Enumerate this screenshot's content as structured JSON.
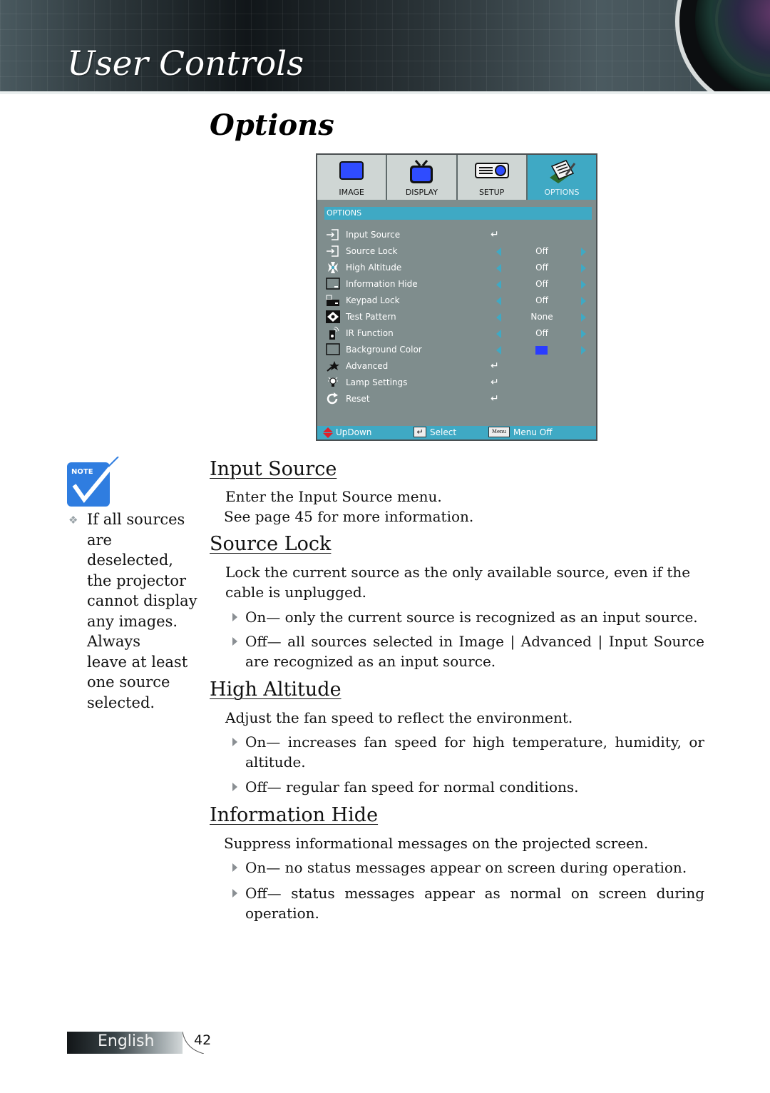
{
  "header": {
    "title": "User Controls",
    "section_title": "Options"
  },
  "osd_menu": {
    "tabs": [
      {
        "label": "IMAGE",
        "icon": "image-monitor-icon",
        "active": false
      },
      {
        "label": "DISPLAY",
        "icon": "display-tv-icon",
        "active": false
      },
      {
        "label": "SETUP",
        "icon": "setup-projector-icon",
        "active": false
      },
      {
        "label": "OPTIONS",
        "icon": "options-notepad-icon",
        "active": true
      }
    ],
    "subheader": "OPTIONS",
    "items": [
      {
        "label": "Input Source",
        "icon": "input-source-icon",
        "type": "enter",
        "value": ""
      },
      {
        "label": "Source Lock",
        "icon": "source-lock-icon",
        "type": "select",
        "value": "Off"
      },
      {
        "label": "High Altitude",
        "icon": "fan-icon",
        "type": "select",
        "value": "Off"
      },
      {
        "label": "Information Hide",
        "icon": "info-hide-icon",
        "type": "select",
        "value": "Off"
      },
      {
        "label": "Keypad Lock",
        "icon": "keypad-lock-icon",
        "type": "select",
        "value": "Off"
      },
      {
        "label": "Test Pattern",
        "icon": "test-pattern-icon",
        "type": "select",
        "value": "None"
      },
      {
        "label": "IR Function",
        "icon": "remote-icon",
        "type": "select",
        "value": "Off"
      },
      {
        "label": "Background Color",
        "icon": "background-color-icon",
        "type": "color",
        "value": "#2a3cff"
      },
      {
        "label": "Advanced",
        "icon": "advanced-icon",
        "type": "enter",
        "value": ""
      },
      {
        "label": "Lamp Settings",
        "icon": "lamp-icon",
        "type": "enter",
        "value": ""
      },
      {
        "label": "Reset",
        "icon": "reset-icon",
        "type": "enter",
        "value": ""
      }
    ],
    "footer": {
      "updown": "UpDown",
      "select": "Select",
      "menu_key": "Menu",
      "menu_off": "Menu Off"
    },
    "colors": {
      "accent": "#3fa9c4",
      "panel": "#7f8d8d",
      "tab_inactive": "#cfd6d4"
    }
  },
  "note": {
    "badge": "NOTE",
    "text": [
      "If all sources",
      "are deselected,",
      "the projector",
      "cannot display",
      "any images.",
      "Always",
      "leave at least",
      "one source",
      "selected."
    ]
  },
  "sections": {
    "input_source": {
      "title": "Input Source",
      "lines": [
        "Enter the Input Source menu.",
        "See page 45 for more information."
      ]
    },
    "source_lock": {
      "title": "Source Lock",
      "desc": "Lock the current source as the only available source, even if the cable is unplugged.",
      "on": "On— only the current source is recognized as an input source.",
      "off": "Off— all sources selected in Image | Advanced | Input Source are recognized as an input source."
    },
    "high_altitude": {
      "title": "High Altitude",
      "desc": "Adjust the fan speed to reflect the environment.",
      "on": "On— increases fan speed for high temperature, humidity, or altitude.",
      "off": "Off— regular fan speed for normal conditions."
    },
    "information_hide": {
      "title": "Information Hide",
      "desc": "Suppress informational messages on the projected screen.",
      "on": "On— no status messages appear on screen during operation.",
      "off": "Off— status messages appear as normal on screen during operation."
    }
  },
  "footer": {
    "language": "English",
    "page_number": "42"
  }
}
